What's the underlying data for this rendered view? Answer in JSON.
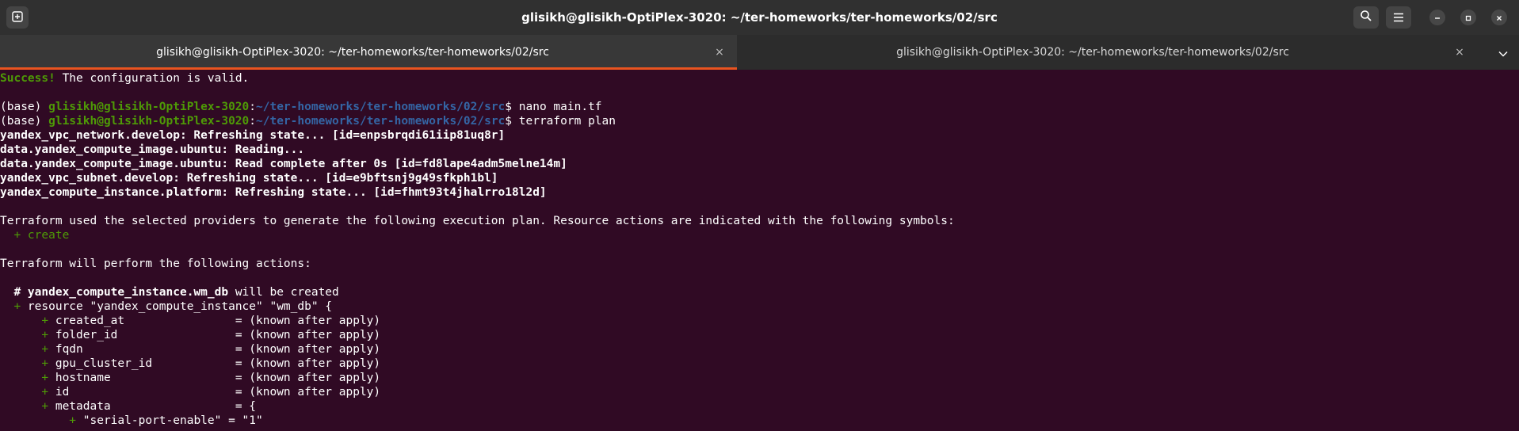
{
  "window": {
    "title": "glisikh@glisikh-OptiPlex-3020: ~/ter-homeworks/ter-homeworks/02/src",
    "icons": {
      "new_tab": "new-tab-icon",
      "search": "search-icon",
      "menu": "hamburger-menu-icon",
      "minimize": "minimize-icon",
      "maximize": "maximize-icon",
      "close": "close-icon"
    }
  },
  "tabs": [
    {
      "label": "glisikh@glisikh-OptiPlex-3020: ~/ter-homeworks/ter-homeworks/02/src",
      "active": true,
      "close": "×"
    },
    {
      "label": "glisikh@glisikh-OptiPlex-3020: ~/ter-homeworks/ter-homeworks/02/src",
      "active": false,
      "close": "×"
    }
  ],
  "colors": {
    "terminal_bg": "#300a24",
    "prompt_user": "#4e9a06",
    "prompt_path": "#3465a4",
    "active_tab_underline": "#e95420"
  },
  "terminal": {
    "success_label": "Success!",
    "success_msg": " The configuration is valid.",
    "prompt_prefix": "(base) ",
    "prompt_user": "glisikh@glisikh-OptiPlex-3020",
    "prompt_colon": ":",
    "prompt_path": "~/ter-homeworks/ter-homeworks/02/src",
    "prompt_dollar": "$ ",
    "cmd1": "nano main.tf",
    "cmd2": "terraform plan",
    "refresh": [
      "yandex_vpc_network.develop: Refreshing state... [id=enpsbrqdi61iip81uq8r]",
      "data.yandex_compute_image.ubuntu: Reading...",
      "data.yandex_compute_image.ubuntu: Read complete after 0s [id=fd8lape4adm5melne14m]",
      "yandex_vpc_subnet.develop: Refreshing state... [id=e9bftsnj9g49sfkph1bl]",
      "yandex_compute_instance.platform: Refreshing state... [id=fhmt93t4jhalrro18l2d]"
    ],
    "plan_intro": "Terraform used the selected providers to generate the following execution plan. Resource actions are indicated with the following symbols:",
    "create_line": "  + create",
    "actions_line": "Terraform will perform the following actions:",
    "comment_hash": "  # ",
    "comment_resource": "yandex_compute_instance.wm_db",
    "comment_suffix": " will be created",
    "resource_plus": "  + ",
    "resource_decl": "resource \"yandex_compute_instance\" \"wm_db\" {",
    "attr_plus": "      + ",
    "attrs": [
      {
        "name": "created_at                = ",
        "value": "(known after apply)"
      },
      {
        "name": "folder_id                 = ",
        "value": "(known after apply)"
      },
      {
        "name": "fqdn                      = ",
        "value": "(known after apply)"
      },
      {
        "name": "gpu_cluster_id            = ",
        "value": "(known after apply)"
      },
      {
        "name": "hostname                  = ",
        "value": "(known after apply)"
      },
      {
        "name": "id                        = ",
        "value": "(known after apply)"
      },
      {
        "name": "metadata                  = ",
        "value": "{"
      }
    ],
    "metadata_plus": "          + ",
    "metadata_entry": "\"serial-port-enable\" = \"1\""
  }
}
